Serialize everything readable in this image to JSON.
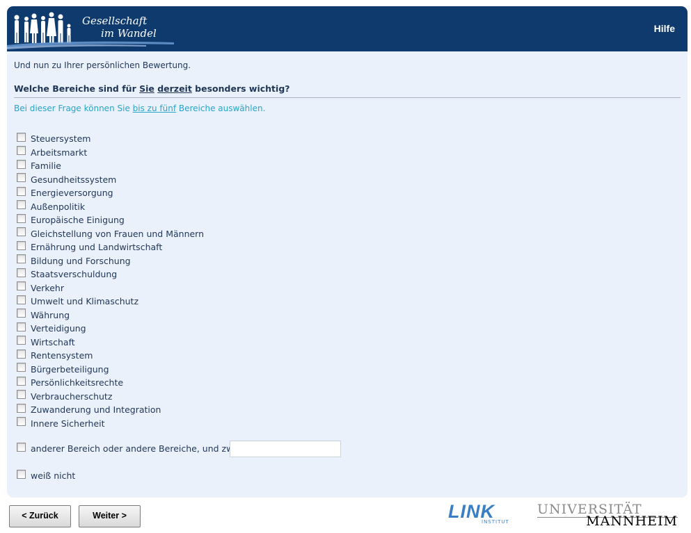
{
  "header": {
    "logo_line1": "Gesellschaft",
    "logo_line2": "im Wandel",
    "help_label": "Hilfe"
  },
  "survey": {
    "intro": "Und nun zu Ihrer persönlichen Bewertung.",
    "question_parts": [
      "Welche Bereiche sind für ",
      "Sie",
      " ",
      "derzeit",
      " besonders wichtig?"
    ],
    "hint_parts": [
      "Bei dieser Frage können Sie ",
      "bis zu fünf",
      " Bereiche auswählen."
    ],
    "options": [
      "Steuersystem",
      "Arbeitsmarkt",
      "Familie",
      "Gesundheitssystem",
      "Energieversorgung",
      "Außenpolitik",
      "Europäische Einigung",
      "Gleichstellung von Frauen und Männern",
      "Ernährung und Landwirtschaft",
      "Bildung und Forschung",
      "Staatsverschuldung",
      "Verkehr",
      "Umwelt und Klimaschutz",
      "Währung",
      "Verteidigung",
      "Wirtschaft",
      "Rentensystem",
      "Bürgerbeteiligung",
      "Persönlichkeitsrechte",
      "Verbraucherschutz",
      "Zuwanderung und Integration",
      "Innere Sicherheit"
    ],
    "other_label": "anderer Bereich oder andere Bereiche, und zwar:",
    "other_value": "",
    "dont_know_label": "weiß nicht"
  },
  "nav": {
    "back_label": "< Zurück",
    "next_label": "Weiter >"
  },
  "logos": {
    "link": "LINK",
    "link_sub": "INSTITUT",
    "uni_line1": "UNIVERSITÄT",
    "uni_line2": "MANNHEIM"
  },
  "colors": {
    "header_bg": "#0f3a6e",
    "content_bg": "#eaf1fb",
    "hint_text": "#2aa4c8",
    "link_logo": "#3a7fc4"
  }
}
